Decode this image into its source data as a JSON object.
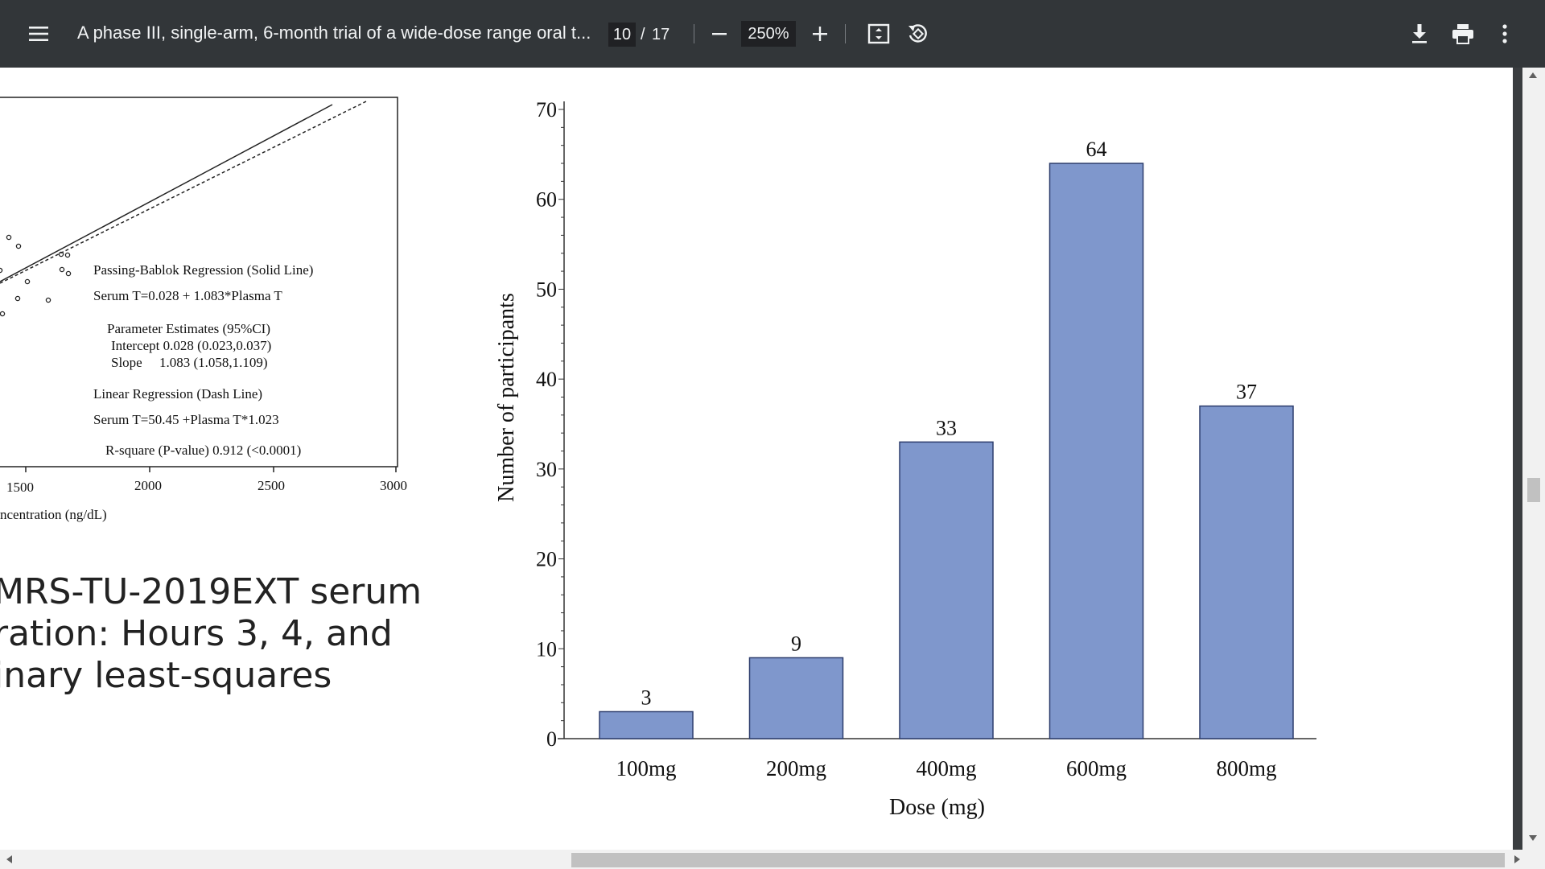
{
  "toolbar": {
    "title": "A phase III, single-arm, 6-month trial of a wide-dose range oral t...",
    "page_current": "10",
    "page_separator": "/",
    "page_total": "17",
    "zoom": "250%",
    "icons": [
      "menu-icon",
      "zoom-out-icon",
      "zoom-in-icon",
      "fit-page-icon",
      "rotate-icon",
      "download-icon",
      "print-icon",
      "more-vert-icon"
    ]
  },
  "left_figure": {
    "annotations": [
      "Passing-Bablok Regression (Solid Line)",
      "Serum T=0.028 + 1.083*Plasma T",
      "Parameter Estimates (95%CI)",
      "Intercept 0.028 (0.023,0.037)",
      "Slope     1.083 (1.058,1.109)",
      "Linear Regression (Dash Line)",
      "Serum T=50.45 +Plasma T*1.023",
      "R-square (P-value) 0.912 (<0.0001)"
    ],
    "x_ticks": [
      "1500",
      "2000",
      "2500",
      "3000"
    ],
    "x_label_fragment": "ncentration (ng/dL)"
  },
  "caption": {
    "line1": "MRS-TU-2019EXT serum",
    "line2": "ration: Hours 3, 4, and",
    "line3": "inary least-squares"
  },
  "chart_data": {
    "type": "bar",
    "categories": [
      "100mg",
      "200mg",
      "400mg",
      "600mg",
      "800mg"
    ],
    "values": [
      3,
      9,
      33,
      64,
      37
    ],
    "data_labels": [
      "3",
      "9",
      "33",
      "64",
      "37"
    ],
    "xlabel": "Dose (mg)",
    "ylabel": "Number of participants",
    "ylim": [
      0,
      70
    ],
    "y_ticks": [
      "0",
      "10",
      "20",
      "30",
      "40",
      "50",
      "60",
      "70"
    ],
    "bar_color": "#7f97cc",
    "grid": false
  }
}
